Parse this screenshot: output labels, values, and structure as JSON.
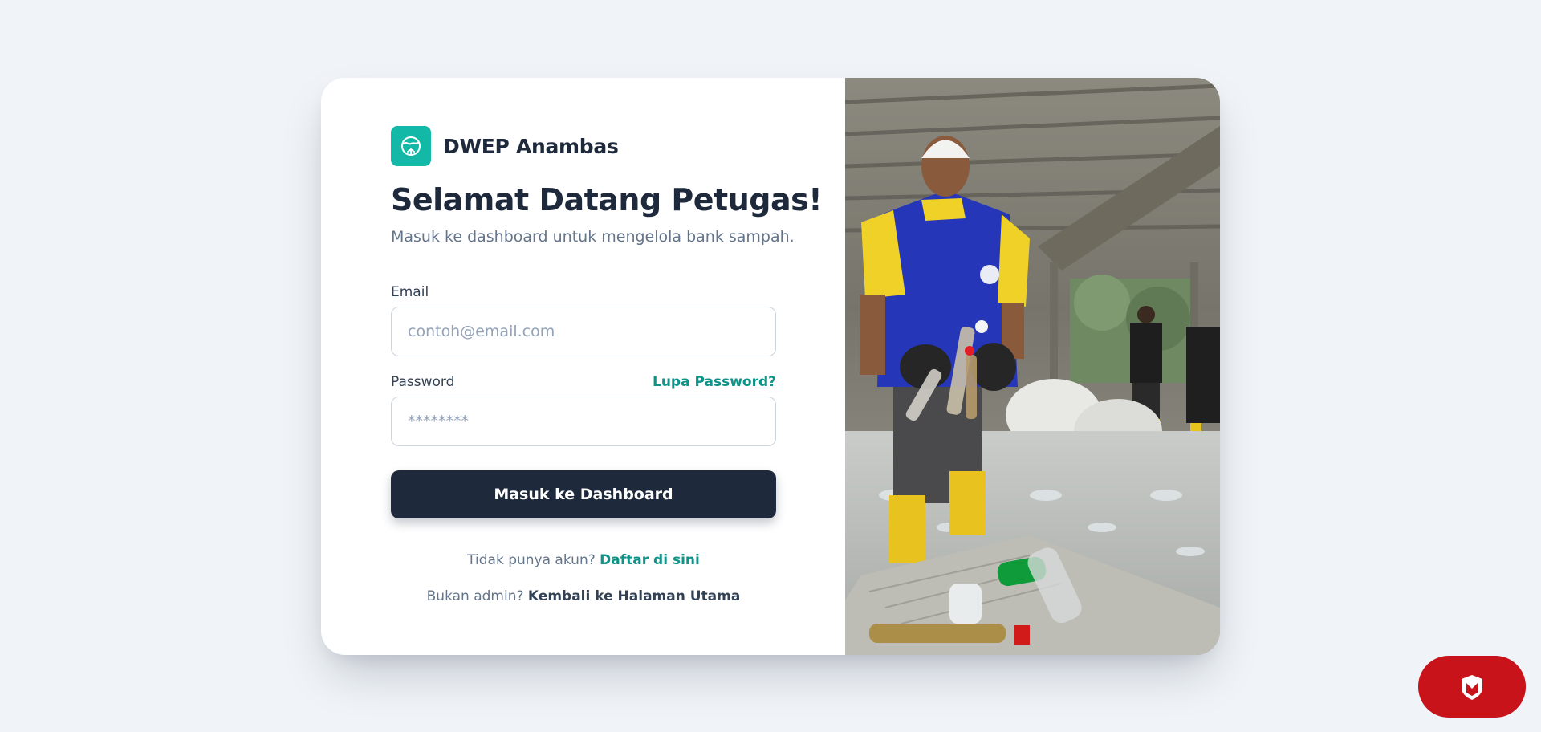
{
  "brand": {
    "name": "DWEP Anambas",
    "logo_icon": "recycle-globe-icon",
    "accent": "#14b8a6"
  },
  "heading": {
    "title": "Selamat Datang Petugas!",
    "subtitle": "Masuk ke dashboard untuk mengelola bank sampah."
  },
  "form": {
    "email_label": "Email",
    "email_placeholder": "contoh@email.com",
    "password_label": "Password",
    "password_placeholder": "********",
    "forgot_link": "Lupa Password?",
    "submit_label": "Masuk ke Dashboard"
  },
  "footer": {
    "register_prompt": "Tidak punya akun?",
    "register_link": "Daftar di sini",
    "back_prompt": "Bukan admin?",
    "back_link": "Kembali ke Halaman Utama"
  },
  "colors": {
    "primary_dark": "#1e293b",
    "link_teal": "#0d9488",
    "background": "#f0f4f8",
    "badge_red": "#c8131a"
  },
  "photo": {
    "subject": "worker-sorting-plastic-bottles-photo"
  },
  "floating_badge": {
    "icon": "security-shield-icon"
  }
}
